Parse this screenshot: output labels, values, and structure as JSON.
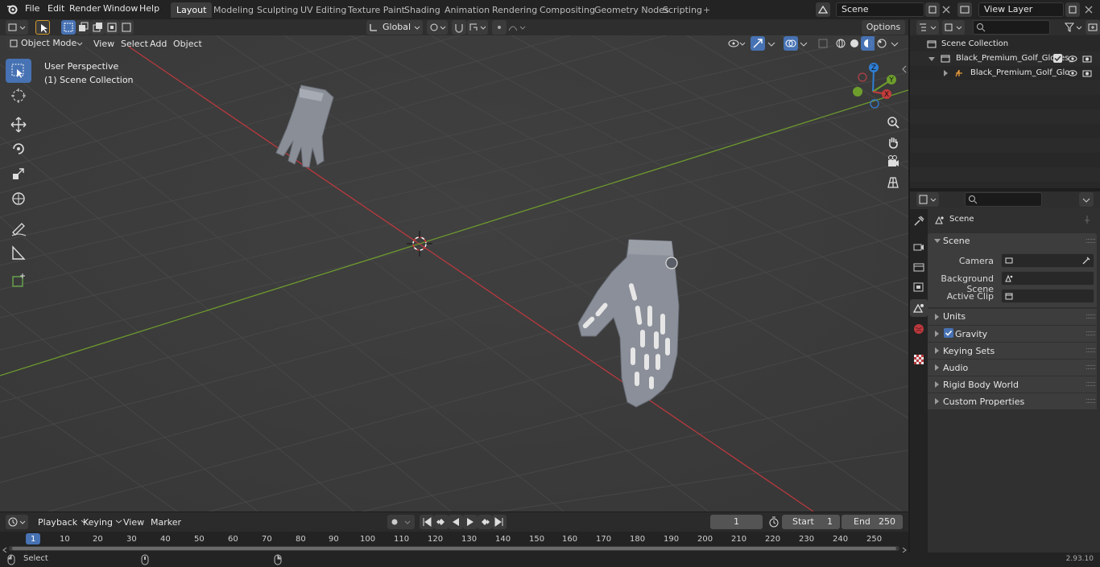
{
  "topbar": {
    "menus": [
      "File",
      "Edit",
      "Render",
      "Window",
      "Help"
    ],
    "workspaces": [
      "Layout",
      "Modeling",
      "Sculpting",
      "UV Editing",
      "Texture Paint",
      "Shading",
      "Animation",
      "Rendering",
      "Compositing",
      "Geometry Nodes",
      "Scripting"
    ],
    "active_workspace": "Layout",
    "add_workspace": "+",
    "scene_name": "Scene",
    "view_layer": "View Layer"
  },
  "tool_header": {
    "transform_orientation": "Global",
    "options_label": "Options"
  },
  "viewport_header": {
    "mode": "Object Mode",
    "menus": [
      "View",
      "Select",
      "Add",
      "Object"
    ]
  },
  "viewport": {
    "overlay_title": "User Perspective",
    "overlay_collection": "(1) Scene Collection",
    "gizmo_axes": [
      "Z",
      "Y",
      "X"
    ],
    "colors": {
      "x_axis": "#c23c3c",
      "y_axis": "#6d9e2c",
      "z_axis": "#2f7fd6",
      "active": "#4772b3"
    }
  },
  "outliner": {
    "root": "Scene Collection",
    "items": [
      "Black_Premium_Golf_Gloves_",
      "Black_Premium_Golf_Glo"
    ]
  },
  "properties": {
    "header": "Scene",
    "panel": "Scene",
    "fields": [
      {
        "label": "Camera",
        "value": ""
      },
      {
        "label": "Background Scene",
        "value": ""
      },
      {
        "label": "Active Clip",
        "value": ""
      }
    ],
    "sections": [
      "Units",
      "Gravity",
      "Keying Sets",
      "Audio",
      "Rigid Body World",
      "Custom Properties"
    ],
    "gravity_checked": true
  },
  "timeline": {
    "menus": [
      "Playback",
      "Keying",
      "View",
      "Marker"
    ],
    "current_frame": "1",
    "start_label": "Start",
    "start_value": "1",
    "end_label": "End",
    "end_value": "250",
    "ruler": [
      "1",
      "10",
      "20",
      "30",
      "40",
      "50",
      "60",
      "70",
      "80",
      "90",
      "100",
      "110",
      "120",
      "130",
      "140",
      "150",
      "160",
      "170",
      "180",
      "190",
      "200",
      "210",
      "220",
      "230",
      "240",
      "250"
    ]
  },
  "statusbar": {
    "left": "Select",
    "version": "2.93.10"
  }
}
